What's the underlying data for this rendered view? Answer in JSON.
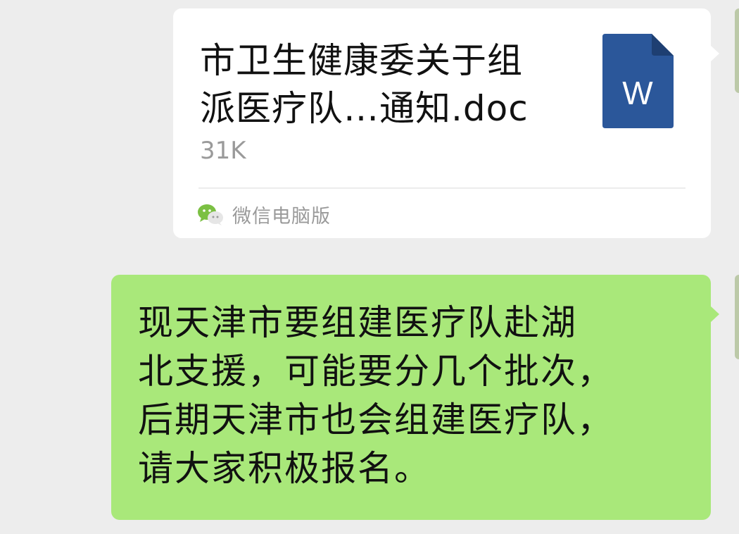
{
  "file_message": {
    "file_name": "市卫生健康委关于组\n派医疗队…通知.doc",
    "file_size": "31K",
    "file_type_icon": "word-doc-icon",
    "file_type_letter": "W",
    "source": "微信电脑版",
    "source_icon": "wechat-icon"
  },
  "text_message": {
    "text": "现天津市要组建医疗队赴湖\n北支援，可能要分几个批次，\n后期天津市也会组建医疗队，\n请大家积极报名。"
  },
  "colors": {
    "background": "#ededed",
    "sent_bubble": "#a9e87a",
    "card": "#ffffff",
    "word_blue": "#2b579a",
    "wechat_green": "#7bc043"
  }
}
